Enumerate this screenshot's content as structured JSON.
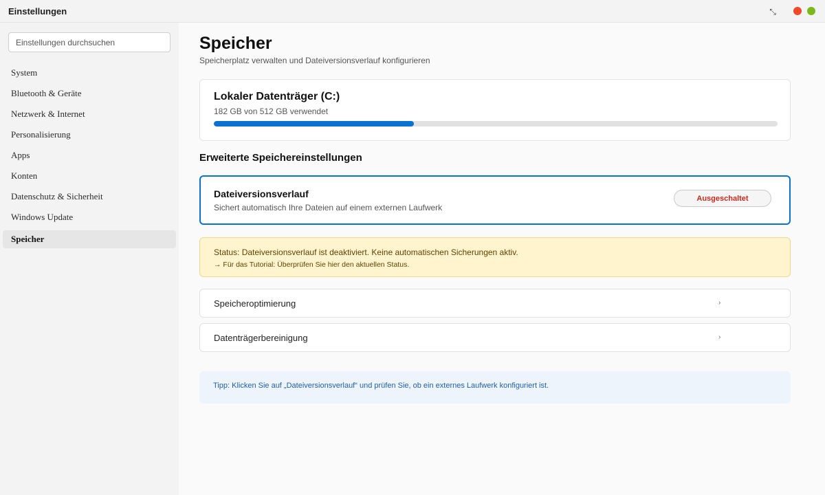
{
  "window": {
    "title": "Einstellungen",
    "resize_glyph": "⤡",
    "controls": [
      "close-dot",
      "maximize-dot"
    ]
  },
  "colors": {
    "accent": "#0a72d0",
    "close_dot": "#ee4a2a",
    "maximize_dot": "#7ab81c",
    "status_off": "#c42b1c",
    "warning_bg": "#fff4ce"
  },
  "sidebar": {
    "search_placeholder": "Einstellungen durchsuchen",
    "items": [
      {
        "label": "System"
      },
      {
        "label": "Bluetooth & Geräte"
      },
      {
        "label": "Netzwerk & Internet"
      },
      {
        "label": "Personalisierung"
      },
      {
        "label": "Apps"
      },
      {
        "label": "Konten"
      },
      {
        "label": "Datenschutz & Sicherheit"
      },
      {
        "label": "Windows Update"
      },
      {
        "label": "Speicher",
        "active": true
      }
    ]
  },
  "main": {
    "title": "Speicher",
    "subtitle": "Speicherplatz verwalten und Dateiversionsverlauf konfigurieren",
    "disk": {
      "name": "Lokaler Datenträger (C:)",
      "usage_text": "182 GB von 512 GB verwendet",
      "used_gb": 182,
      "total_gb": 512
    },
    "section_heading": "Erweiterte Speichereinstellungen",
    "file_history": {
      "title": "Dateiversionsverlauf",
      "description": "Sichert automatisch Ihre Dateien auf einem externen Laufwerk",
      "toggle_label": "Ausgeschaltet"
    },
    "status": {
      "line": "Status: Dateiversionsverlauf ist deaktiviert. Keine automatischen Sicherungen aktiv.",
      "hint": "→ Für das Tutorial: Überprüfen Sie hier den aktuellen Status."
    },
    "rows": [
      {
        "label": "Speicheroptimierung",
        "chevron": "›"
      },
      {
        "label": "Datenträgerbereinigung",
        "chevron": "›"
      }
    ],
    "tip": "Tipp: Klicken Sie auf „Dateiversionsverlauf“ und prüfen Sie, ob ein externes Laufwerk konfiguriert ist."
  }
}
